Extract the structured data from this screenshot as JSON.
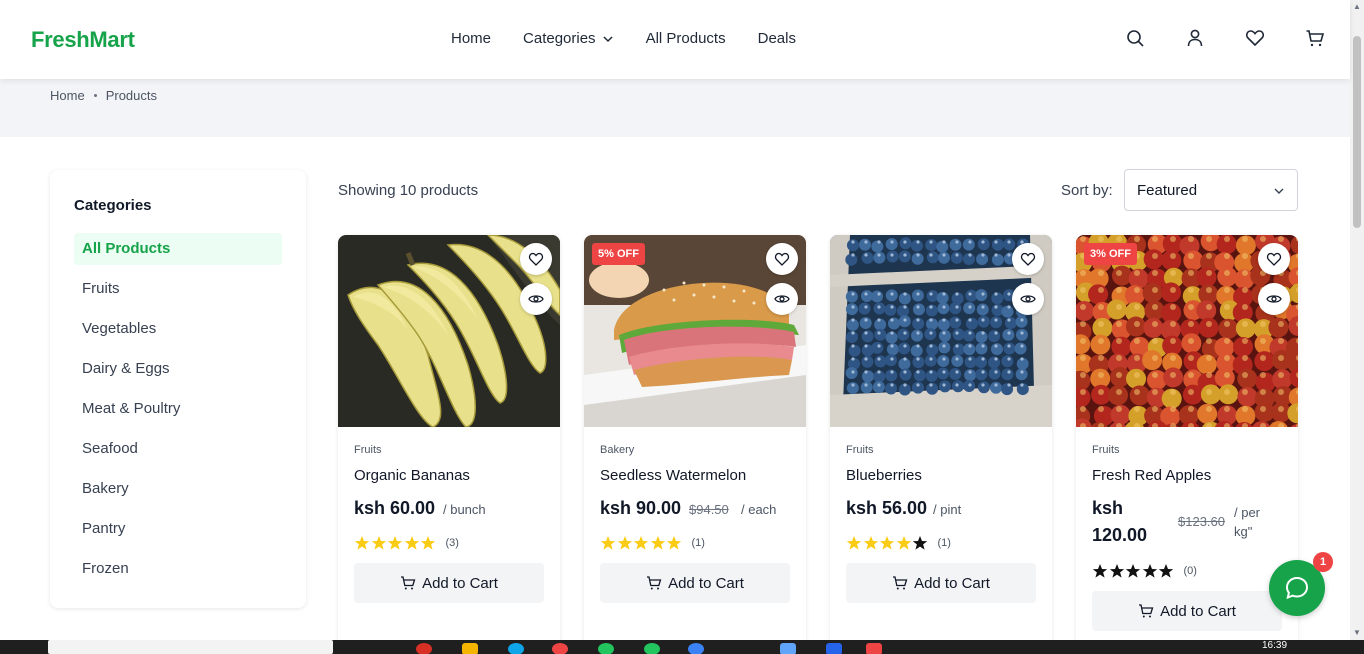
{
  "header": {
    "logo": "FreshMart",
    "nav": [
      {
        "label": "Home"
      },
      {
        "label": "Categories"
      },
      {
        "label": "All Products"
      },
      {
        "label": "Deals"
      }
    ]
  },
  "breadcrumb": {
    "items": [
      "Home",
      "Products"
    ]
  },
  "sidebar": {
    "title": "Categories",
    "items": [
      "All Products",
      "Fruits",
      "Vegetables",
      "Dairy & Eggs",
      "Meat & Poultry",
      "Seafood",
      "Bakery",
      "Pantry",
      "Frozen"
    ],
    "active_index": 0
  },
  "toolbar": {
    "showing": "Showing 10 products",
    "sort_label": "Sort by:",
    "sort_value": "Featured"
  },
  "products": [
    {
      "category": "Fruits",
      "name": "Organic Bananas",
      "price": "ksh 60.00",
      "old_price": "",
      "unit": "/ bunch",
      "badge": "",
      "rating": 5,
      "reviews": "(3)",
      "add_label": "Add to Cart",
      "image": "bananas"
    },
    {
      "category": "Bakery",
      "name": "Seedless Watermelon",
      "price": "ksh 90.00",
      "old_price": "$94.50",
      "unit": "/ each",
      "badge": "5% OFF",
      "rating": 5,
      "reviews": "(1)",
      "add_label": "Add to Cart",
      "image": "sandwich"
    },
    {
      "category": "Fruits",
      "name": "Blueberries",
      "price": "ksh 56.00",
      "old_price": "",
      "unit": "/ pint",
      "badge": "",
      "rating": 4,
      "reviews": "(1)",
      "add_label": "Add to Cart",
      "image": "blueberries"
    },
    {
      "category": "Fruits",
      "name": "Fresh Red Apples",
      "price_line1": "ksh",
      "price_line2": "120.00",
      "old_price": "$123.60",
      "unit_line1": "/ per",
      "unit_line2": "kg\"",
      "badge": "3% OFF",
      "rating": 0,
      "reviews": "(0)",
      "add_label": "Add to Cart",
      "image": "apples"
    }
  ],
  "chat": {
    "badge": "1"
  },
  "taskbar": {
    "time": "16:39"
  },
  "colors": {
    "brand": "#16a34a",
    "badge": "#ef4444",
    "star": "#facc15"
  }
}
